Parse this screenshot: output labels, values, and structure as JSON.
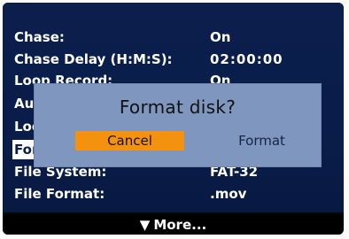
{
  "menu": {
    "items": [
      {
        "label": "Chase:",
        "value": "On"
      },
      {
        "label": "Chase Delay (H:M:S):",
        "value": "02:00:00"
      },
      {
        "label": "Loop Record:",
        "value": "On"
      },
      {
        "label": "Aud",
        "value": ""
      },
      {
        "label": "Loo",
        "value": ""
      },
      {
        "label": "For",
        "value": ""
      },
      {
        "label": "File System:",
        "value": "FAT-32"
      },
      {
        "label": "File Format:",
        "value": ".mov"
      }
    ],
    "more_label": "More..."
  },
  "dialog": {
    "title": "Format disk?",
    "cancel_label": "Cancel",
    "format_label": "Format"
  },
  "colors": {
    "menu_background": "#0a1d4a",
    "dialog_background": "#7f96be",
    "cancel_highlight": "#f4920f"
  }
}
